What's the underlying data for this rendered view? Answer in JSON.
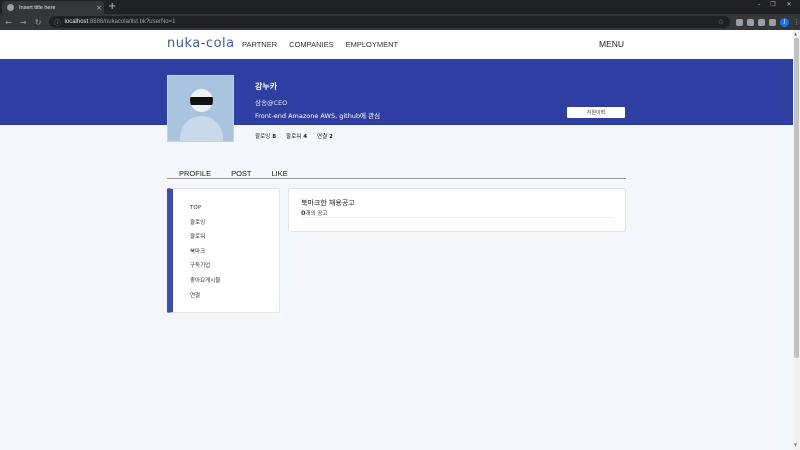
{
  "browser": {
    "tab_title": "Insert title here",
    "tab_close": "×",
    "new_tab": "+",
    "window_controls": [
      "–",
      "❐",
      "✕"
    ],
    "url_host": "localhost",
    "url_path": ":8888/nukacola/list.bk?userNo=1",
    "profile_initial": "J"
  },
  "header": {
    "logo": "nuka-cola",
    "nav": [
      "PARTNER",
      "COMPANIES",
      "EMPLOYMENT"
    ],
    "menu": "MENU"
  },
  "profile": {
    "name": "강누카",
    "role": "삼송@CEO",
    "bio": "Front-end Amazone AWS, github에 관심",
    "apply_button": "지원이력",
    "stats": [
      {
        "label": "팔로잉",
        "value": "8"
      },
      {
        "label": "팔로워",
        "value": "4"
      },
      {
        "label": "연결",
        "value": "2"
      }
    ]
  },
  "tabs": [
    "PROFILE",
    "POST",
    "LIKE"
  ],
  "sidebar": {
    "items": [
      "TOP",
      "팔로잉",
      "팔로워",
      "북마크",
      "구독기업",
      "좋아요게시물",
      "연결"
    ]
  },
  "bookmark": {
    "title": "북마크한 채용공고",
    "count": "0",
    "count_suffix": "개의 공고"
  },
  "colors": {
    "banner": "#2e3ea1",
    "logo": "#3b5aa6",
    "sidebar_accent": "#3e4fa8",
    "page_bg": "#f3f6fa"
  }
}
